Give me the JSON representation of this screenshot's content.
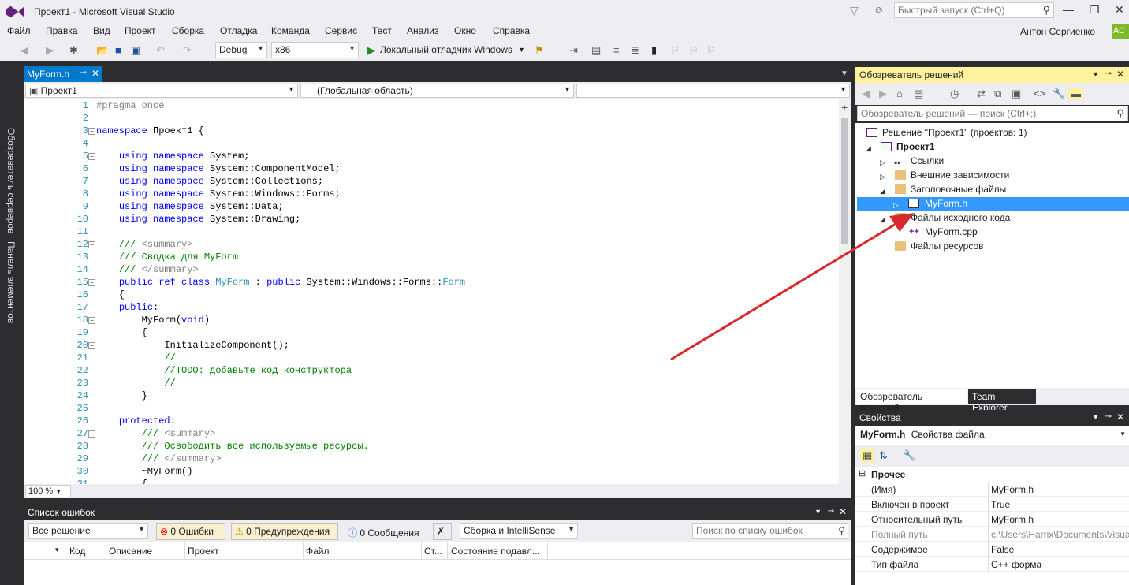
{
  "window": {
    "title": "Проект1 - Microsoft Visual Studio",
    "quick_launch_placeholder": "Быстрый запуск (Ctrl+Q)",
    "user": "Антон Сергиенко",
    "avatar": "АС"
  },
  "menu": [
    "Файл",
    "Правка",
    "Вид",
    "Проект",
    "Сборка",
    "Отладка",
    "Команда",
    "Сервис",
    "Тест",
    "Анализ",
    "Окно",
    "Справка"
  ],
  "toolbar": {
    "config": "Debug",
    "platform": "x86",
    "debugger": "Локальный отладчик Windows"
  },
  "left_strip": {
    "server_explorer": "Обозреватель серверов",
    "toolbox": "Панель элементов"
  },
  "editor": {
    "tab": "MyForm.h",
    "nav_project": "Проект1",
    "nav_scope": "(Глобальная область)",
    "zoom": "100 %",
    "lines": [
      "1",
      "2",
      "3",
      "4",
      "5",
      "6",
      "7",
      "8",
      "9",
      "10",
      "11",
      "12",
      "13",
      "14",
      "15",
      "16",
      "17",
      "18",
      "19",
      "20",
      "21",
      "22",
      "23",
      "24",
      "25",
      "26",
      "27",
      "28",
      "29",
      "30",
      "31"
    ]
  },
  "error_list": {
    "title": "Список ошибок",
    "scope": "Все решение",
    "errors": "0 Ошибки",
    "warnings": "0 Предупреждения",
    "messages": "0 Сообщения",
    "source": "Сборка и IntelliSense",
    "search_placeholder": "Поиск по списку ошибок",
    "columns": [
      "Код",
      "Описание",
      "Проект",
      "Файл",
      "Ст...",
      "Состояние подавл..."
    ]
  },
  "solution_explorer": {
    "title": "Обозреватель решений",
    "search_placeholder": "Обозреватель решений — поиск (Ctrl+;)",
    "solution": "Решение \"Проект1\"  (проектов: 1)",
    "project": "Проект1",
    "refs": "Ссылки",
    "ext_deps": "Внешние зависимости",
    "headers": "Заголовочные файлы",
    "myform_h": "MyForm.h",
    "sources": "Файлы исходного кода",
    "myform_cpp": "MyForm.cpp",
    "resources": "Файлы ресурсов",
    "tab_se": "Обозреватель решений",
    "tab_te": "Team Explorer"
  },
  "properties": {
    "title": "Свойства",
    "object": "MyForm.h",
    "object_type": "Свойства файла",
    "category": "Прочее",
    "rows": [
      {
        "k": "(Имя)",
        "v": "MyForm.h"
      },
      {
        "k": "Включен в проект",
        "v": "True"
      },
      {
        "k": "Относительный путь",
        "v": "MyForm.h"
      },
      {
        "k": "Полный путь",
        "v": "c:\\Users\\Harrix\\Documents\\Visua"
      },
      {
        "k": "Содержимое",
        "v": "False"
      },
      {
        "k": "Тип файла",
        "v": "C++ форма"
      }
    ]
  },
  "colors": {
    "accent": "#007acc",
    "highlight": "#3399ff",
    "solution_header": "#fff29d",
    "arrow": "#d62b2b"
  }
}
